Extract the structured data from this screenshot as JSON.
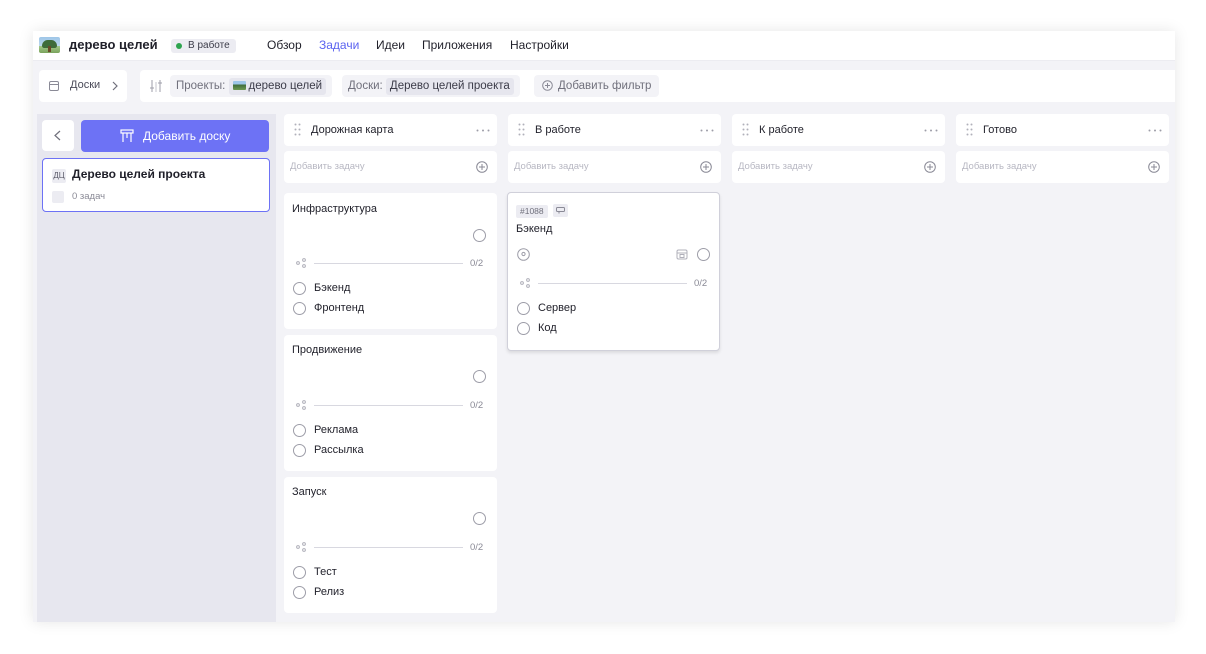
{
  "header": {
    "project_title": "дерево целей",
    "status": "В работе",
    "nav": [
      {
        "label": "Обзор",
        "active": false
      },
      {
        "label": "Задачи",
        "active": true
      },
      {
        "label": "Идеи",
        "active": false
      },
      {
        "label": "Приложения",
        "active": false
      },
      {
        "label": "Настройки",
        "active": false
      }
    ],
    "colors": {
      "accent": "#5b63f0",
      "status_dot": "#2ea44f"
    }
  },
  "filterbar": {
    "crumb_label": "Доски",
    "projects_label": "Проекты:",
    "projects_value": "дерево целей",
    "boards_label": "Доски:",
    "boards_value": "Дерево целей проекта",
    "add_filter_label": "Добавить фильтр"
  },
  "sidebar": {
    "add_board_label": "Добавить доску",
    "boards": [
      {
        "abbr": "ДЦ",
        "name": "Дерево целей проекта",
        "tasks": "0 задач"
      }
    ],
    "colors": {
      "button": "#6d72f5"
    }
  },
  "add_task_placeholder": "Добавить задачу",
  "columns": [
    {
      "title": "Дорожная карта",
      "cards": [
        {
          "title": "Инфраструктура",
          "progress": "0/2",
          "subtasks": [
            "Бэкенд",
            "Фронтенд"
          ]
        },
        {
          "title": "Продвижение",
          "progress": "0/2",
          "subtasks": [
            "Реклама",
            "Рассылка"
          ]
        },
        {
          "title": "Запуск",
          "progress": "0/2",
          "subtasks": [
            "Тест",
            "Релиз"
          ]
        }
      ]
    },
    {
      "title": "В работе",
      "cards": [
        {
          "id": "#1088",
          "title": "Бэкенд",
          "progress": "0/2",
          "subtasks": [
            "Сервер",
            "Код"
          ]
        }
      ]
    },
    {
      "title": "К работе",
      "cards": []
    },
    {
      "title": "Готово",
      "cards": []
    }
  ]
}
